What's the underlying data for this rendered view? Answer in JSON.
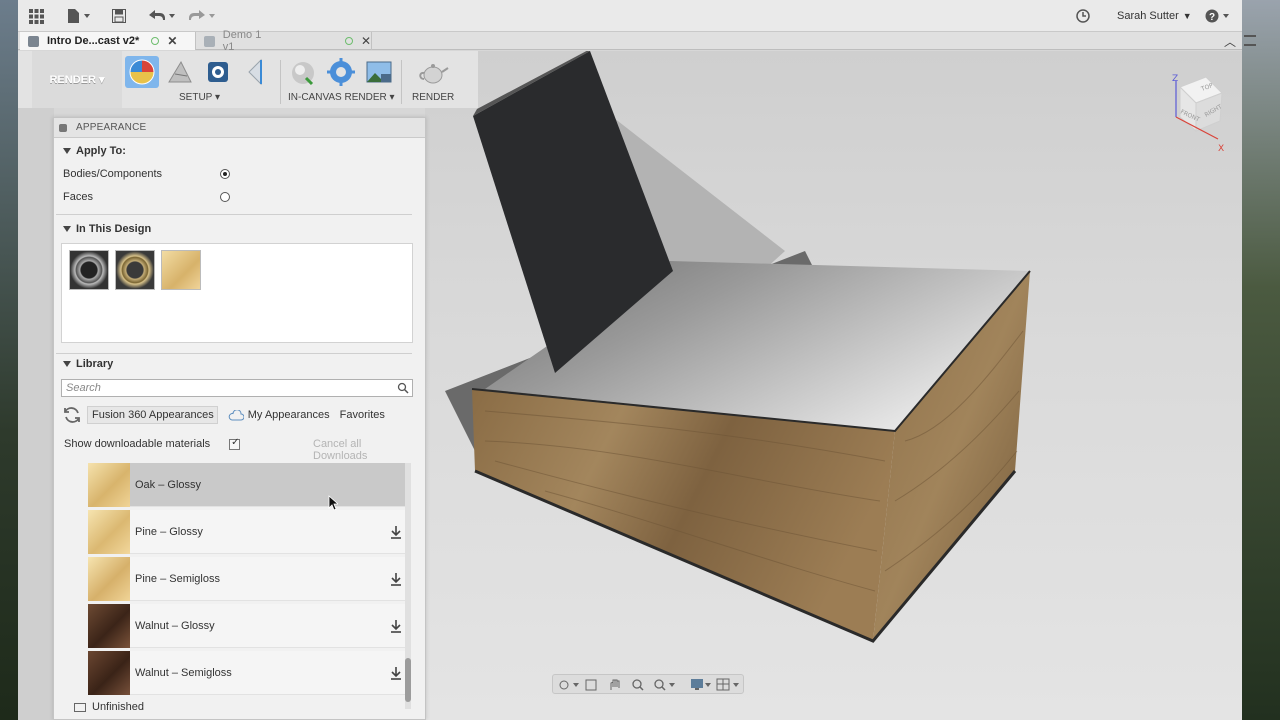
{
  "topbar": {
    "user_name": "Sarah Sutter"
  },
  "tabs": [
    {
      "label": "Intro De...cast v2*"
    },
    {
      "label": "Demo 1 v1"
    }
  ],
  "ribbon": {
    "workspace": "RENDER",
    "groups": [
      {
        "label": "SETUP"
      },
      {
        "label": "IN-CANVAS RENDER"
      },
      {
        "label": "RENDER"
      }
    ]
  },
  "panel": {
    "title": "APPEARANCE",
    "apply_to": {
      "title": "Apply To:",
      "options": [
        {
          "label": "Bodies/Components",
          "selected": true
        },
        {
          "label": "Faces",
          "selected": false
        }
      ]
    },
    "in_this_design": {
      "title": "In This Design",
      "thumbnails": [
        "chrome-ring",
        "gold-ring",
        "oak-cube"
      ]
    },
    "library": {
      "title": "Library",
      "search_placeholder": "Search",
      "tabs": [
        "Fusion 360 Appearances",
        "My Appearances",
        "Favorites"
      ],
      "selected_tab": "Fusion 360 Appearances",
      "show_downloadable_label": "Show downloadable materials",
      "show_downloadable": true,
      "cancel_downloads": "Cancel all Downloads",
      "materials": [
        {
          "name": "Oak – Glossy",
          "downloaded": true,
          "wood": "light"
        },
        {
          "name": "Pine – Glossy",
          "downloaded": false,
          "wood": "light"
        },
        {
          "name": "Pine – Semigloss",
          "downloaded": false,
          "wood": "light"
        },
        {
          "name": "Walnut – Glossy",
          "downloaded": false,
          "wood": "dark"
        },
        {
          "name": "Walnut – Semigloss",
          "downloaded": false,
          "wood": "dark"
        }
      ],
      "folder": "Unfinished"
    }
  },
  "viewcube": {
    "faces": [
      "TOP",
      "FRONT",
      "RIGHT"
    ],
    "axes": [
      "Z",
      "X"
    ]
  },
  "colors": {
    "accent_blue": "#2f7fd3",
    "axis_x": "#d9443a",
    "axis_z": "#5a5ad6"
  }
}
